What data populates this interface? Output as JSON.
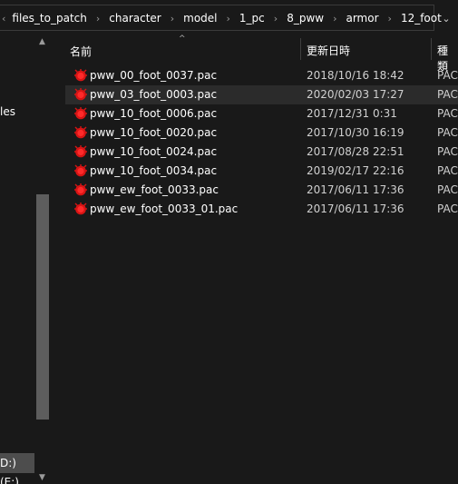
{
  "address": {
    "lead_glyph": "‹",
    "crumbs": [
      "files_to_patch",
      "character",
      "model",
      "1_pc",
      "8_pww",
      "armor",
      "12_foot"
    ],
    "separator": "›",
    "dropdown": "⌄"
  },
  "nav": {
    "partial_item": "les",
    "drive_partial": "D:)",
    "drive_sub_partial": "(E:)"
  },
  "columns": {
    "name": "名前",
    "date": "更新日時",
    "type": "種類"
  },
  "files": [
    {
      "name": "pww_00_foot_0037.pac",
      "date": "2018/10/16 18:42",
      "type": "PAC"
    },
    {
      "name": "pww_03_foot_0003.pac",
      "date": "2020/02/03 17:27",
      "type": "PAC"
    },
    {
      "name": "pww_10_foot_0006.pac",
      "date": "2017/12/31 0:31",
      "type": "PAC"
    },
    {
      "name": "pww_10_foot_0020.pac",
      "date": "2017/10/30 16:19",
      "type": "PAC"
    },
    {
      "name": "pww_10_foot_0024.pac",
      "date": "2017/08/28 22:51",
      "type": "PAC"
    },
    {
      "name": "pww_10_foot_0034.pac",
      "date": "2019/02/17 22:16",
      "type": "PAC"
    },
    {
      "name": "pww_ew_foot_0033.pac",
      "date": "2017/06/11 17:36",
      "type": "PAC"
    },
    {
      "name": "pww_ew_foot_0033_01.pac",
      "date": "2017/06/11 17:36",
      "type": "PAC"
    }
  ],
  "icons": {
    "file": "pac-file-icon",
    "file_color": "#e01515"
  }
}
